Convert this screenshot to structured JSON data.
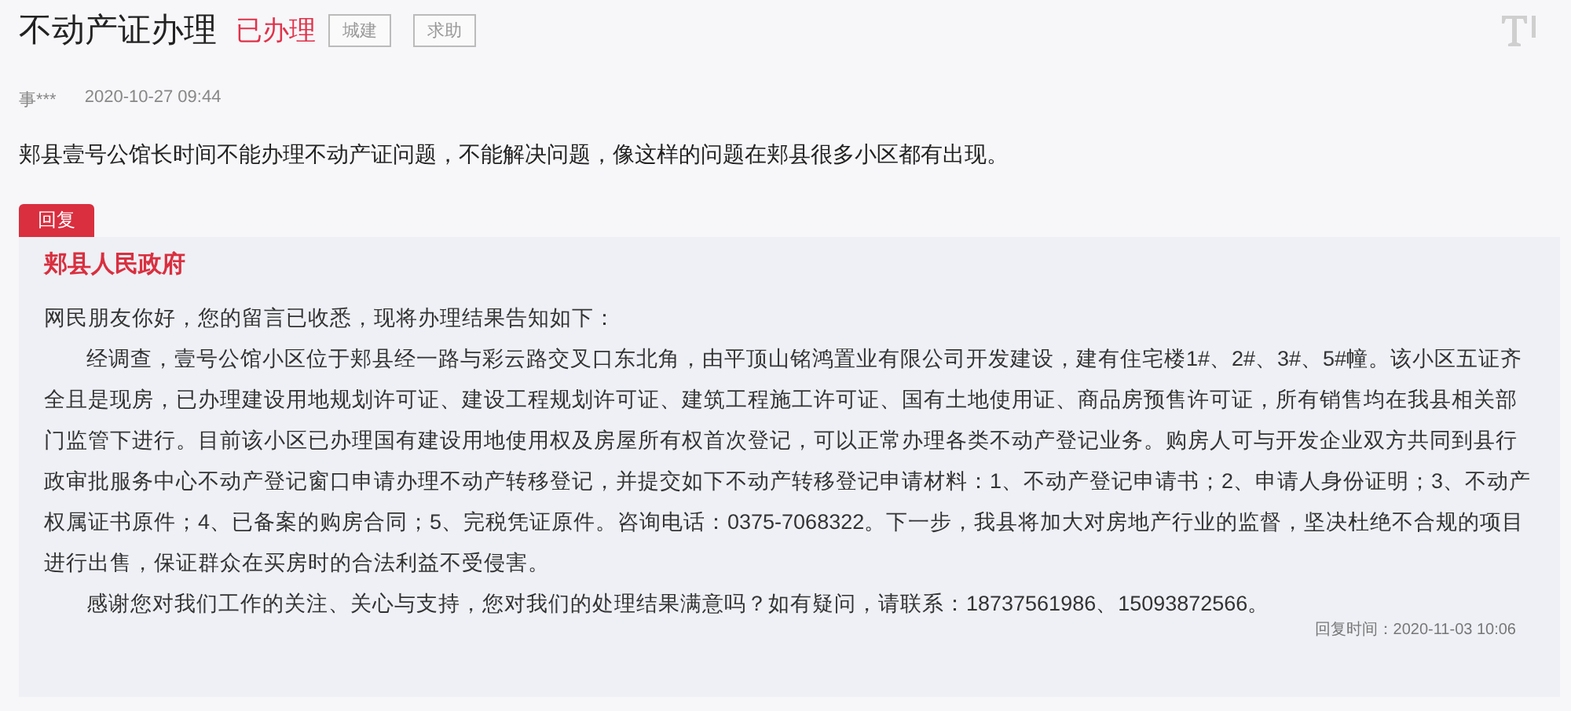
{
  "title": "不动产证办理",
  "status": "已办理",
  "tags": [
    "城建",
    "求助"
  ],
  "author": "事***",
  "date": "2020-10-27 09:44",
  "question": "郏县壹号公馆长时间不能办理不动产证问题，不能解决问题，像这样的问题在郏县很多小区都有出现。",
  "reply": {
    "tag": "回复",
    "org": "郏县人民政府",
    "paragraphs": [
      {
        "kind": "plain",
        "text": "网民朋友你好，您的留言已收悉，现将办理结果告知如下："
      },
      {
        "kind": "indent",
        "text": "经调查，壹号公馆小区位于郏县经一路与彩云路交叉口东北角，由平顶山铭鸿置业有限公司开发建设，建有住宅楼1#、2#、3#、5#幢。该小区五证齐全且是现房，已办理建设用地规划许可证、建设工程规划许可证、建筑工程施工许可证、国有土地使用证、商品房预售许可证，所有销售均在我县相关部门监管下进行。目前该小区已办理国有建设用地使用权及房屋所有权首次登记，可以正常办理各类不动产登记业务。购房人可与开发企业双方共同到县行政审批服务中心不动产登记窗口申请办理不动产转移登记，并提交如下不动产转移登记申请材料：1、不动产登记申请书；2、申请人身份证明；3、不动产权属证书原件；4、已备案的购房合同；5、完税凭证原件。咨询电话：0375-7068322。下一步，我县将加大对房地产行业的监督，坚决杜绝不合规的项目进行出售，保证群众在买房时的合法利益不受侵害。"
      },
      {
        "kind": "indent",
        "text": "感谢您对我们工作的关注、关心与支持，您对我们的处理结果满意吗？如有疑问，请联系：18737561986、15093872566。"
      }
    ],
    "time_label": "回复时间：",
    "time": "2020-11-03 10:06"
  }
}
